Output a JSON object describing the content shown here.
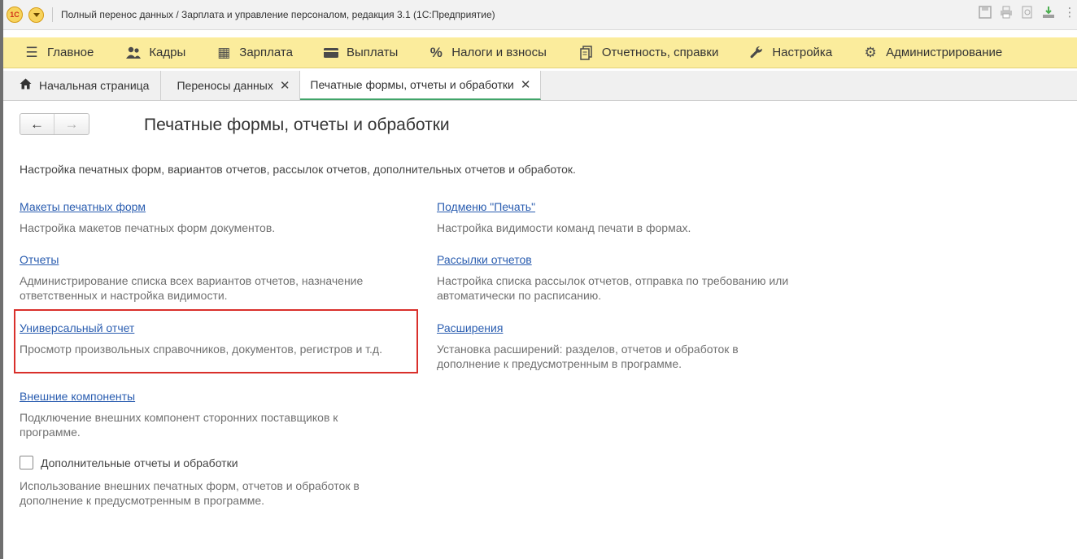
{
  "window": {
    "title": "Полный перенос данных / Зарплата и управление персоналом, редакция 3.1  (1С:Предприятие)",
    "logo_text": "1С"
  },
  "sections": [
    {
      "label": "Главное",
      "icon": "hamburger-menu-icon"
    },
    {
      "label": "Кадры",
      "icon": "people-icon"
    },
    {
      "label": "Зарплата",
      "icon": "calculator-icon"
    },
    {
      "label": "Выплаты",
      "icon": "wallet-icon"
    },
    {
      "label": "Налоги и взносы",
      "icon": "percent-icon"
    },
    {
      "label": "Отчетность, справки",
      "icon": "documents-icon"
    },
    {
      "label": "Настройка",
      "icon": "wrench-icon"
    },
    {
      "label": "Администрирование",
      "icon": "gear-icon"
    }
  ],
  "tabs": [
    {
      "label": "Начальная страница"
    },
    {
      "label": "Переносы данных"
    },
    {
      "label": "Печатные формы, отчеты и обработки"
    }
  ],
  "page": {
    "title": "Печатные формы, отчеты и обработки",
    "intro": "Настройка печатных форм, вариантов отчетов, рассылок отчетов, дополнительных отчетов и обработок."
  },
  "items": {
    "layouts": {
      "link": "Макеты печатных форм",
      "desc": "Настройка макетов печатных форм документов."
    },
    "print_submenu": {
      "link": "Подменю \"Печать\"",
      "desc": "Настройка видимости команд печати в формах."
    },
    "reports": {
      "link": "Отчеты",
      "desc": "Администрирование списка всех вариантов отчетов, назначение\nответственных и настройка видимости."
    },
    "mailings": {
      "link": "Рассылки отчетов",
      "desc": "Настройка списка рассылок отчетов, отправка по требованию или\nавтоматически по расписанию."
    },
    "universal_report": {
      "link": "Универсальный отчет",
      "desc": "Просмотр произвольных справочников, документов, регистров и т.д."
    },
    "extensions": {
      "link": "Расширения",
      "desc": "Установка расширений: разделов, отчетов и обработок в\nдополнение к предусмотренным в программе."
    },
    "external_components": {
      "link": "Внешние компоненты",
      "desc": "Подключение внешних компонент сторонних поставщиков к\nпрограмме."
    }
  },
  "additional": {
    "label": "Дополнительные отчеты и обработки",
    "checked": false,
    "desc": "Использование внешних печатных форм, отчетов и обработок в\nдополнение к предусмотренным в программе."
  },
  "colors": {
    "sections_bar": "#fbec9c",
    "link": "#2a5db0",
    "highlight": "#d9302b",
    "active_tab_underline": "#41a46a"
  }
}
